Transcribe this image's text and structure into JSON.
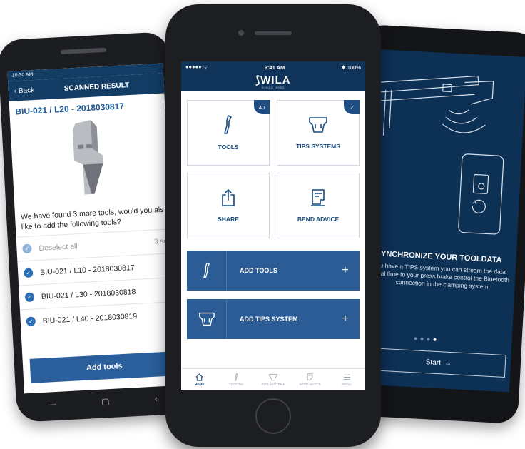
{
  "left_phone": {
    "status_time": "10:30 AM",
    "back_label": "Back",
    "header_title": "SCANNED RESULT",
    "product_code": "BIU-021 / L20 - 2018030817",
    "question": "We have found 3 more tools, would you als like to add the following tools?",
    "deselect_label": "Deselect all",
    "selected_count": "3 sel",
    "items": [
      "BIU-021 / L10 - 2018030817",
      "BIU-021 / L30 - 2018030818",
      "BIU-021 / L40 - 2018030819"
    ],
    "add_button": "Add tools"
  },
  "center_phone": {
    "status": {
      "carrier": "●●●●● ᯤ",
      "time": "9:41 AM",
      "battery": "✱ 100%"
    },
    "brand": {
      "logo": "WILA",
      "tagline": "SINCE 1932"
    },
    "tiles": [
      {
        "label": "TOOLS",
        "badge": "40",
        "icon": "tool-profile-icon"
      },
      {
        "label": "TIPS SYSTEMS",
        "badge": "2",
        "icon": "tips-system-icon"
      },
      {
        "label": "SHARE",
        "icon": "share-icon"
      },
      {
        "label": "BEND ADVICE",
        "icon": "bend-advice-icon"
      }
    ],
    "actions": [
      {
        "label": "ADD TOOLS",
        "plus": "+"
      },
      {
        "label": "ADD TIPS SYSTEM",
        "plus": "+"
      }
    ],
    "tabs": [
      "HOME",
      "TOOLING",
      "TIPS SYSTEMS",
      "BEND ADVICE",
      "MENU"
    ]
  },
  "right_phone": {
    "title": "SYNCHRONIZE YOUR TOOLDATA",
    "body": "u have a TIPS system you can stream the data real time to your press brake control the Bluetooth connection in the clamping system",
    "start_button": "Start",
    "start_arrow": "→",
    "dots": 5,
    "active_dot": 4
  },
  "colors": {
    "navy": "#0f3359",
    "accent_blue": "#2b5c95",
    "tile_text": "#174a7e"
  }
}
